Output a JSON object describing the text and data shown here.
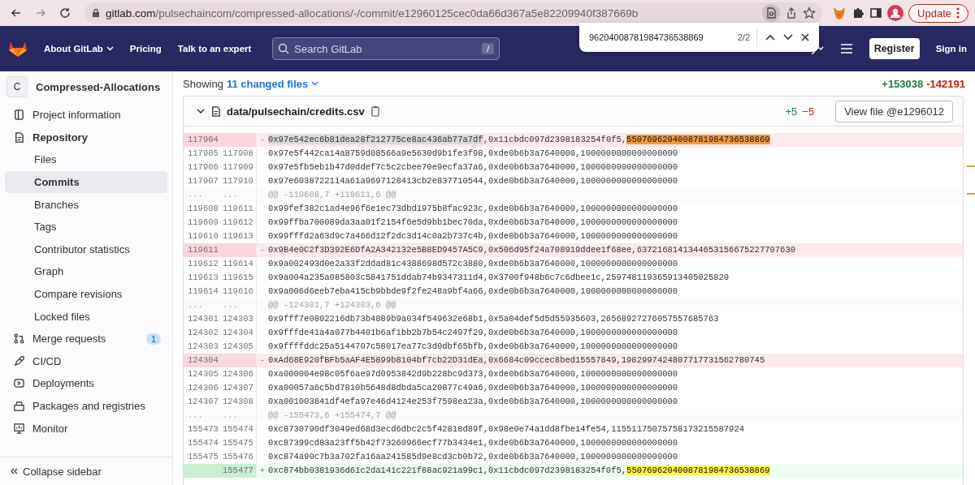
{
  "browser": {
    "url_host": "gitlab.com",
    "url_path": "/pulsechaincom/compressed-allocations/-/commit/e12960125cec0da66d367a5e82209940f387669b",
    "update_button": "Update"
  },
  "find_bar": {
    "query": "96204008781984736538869",
    "count": "2/2"
  },
  "navbar": {
    "links": [
      {
        "label": "About GitLab",
        "dropdown": true
      },
      {
        "label": "Pricing",
        "dropdown": false
      },
      {
        "label": "Talk to an expert",
        "dropdown": false
      }
    ],
    "search": {
      "placeholder": "Search GitLab",
      "shortcut": "/"
    },
    "register": "Register",
    "sign_in": "Sign in"
  },
  "sidebar": {
    "project_initial": "C",
    "project_name": "Compressed-Allocations",
    "items": [
      {
        "label": "Project information",
        "selected": false
      },
      {
        "label": "Repository",
        "selected": false,
        "children": [
          {
            "label": "Files",
            "selected": false
          },
          {
            "label": "Commits",
            "selected": true
          },
          {
            "label": "Branches",
            "selected": false
          },
          {
            "label": "Tags",
            "selected": false
          },
          {
            "label": "Contributor statistics",
            "selected": false
          },
          {
            "label": "Graph",
            "selected": false
          },
          {
            "label": "Compare revisions",
            "selected": false
          },
          {
            "label": "Locked files",
            "selected": false
          }
        ]
      },
      {
        "label": "Merge requests",
        "selected": false,
        "badge": "1"
      },
      {
        "label": "CI/CD",
        "selected": false
      },
      {
        "label": "Deployments",
        "selected": false
      },
      {
        "label": "Packages and registries",
        "selected": false
      },
      {
        "label": "Monitor",
        "selected": false
      }
    ],
    "collapse": "Collapse sidebar"
  },
  "summary": {
    "prefix": "Showing",
    "link": "11 changed files",
    "additions": "+153038",
    "deletions": "-142191"
  },
  "file": {
    "path": "data/pulsechain/credits.csv",
    "additions": "+5",
    "deletions": "−5",
    "view_button": "View file @e1296012",
    "lines": [
      {
        "kind": "deleted",
        "old": "117904",
        "sign": "-",
        "parts": [
          {
            "text": "0x97e542ec6b81dea28f212775ce8ac436ab77a7df",
            "kind": "selection"
          },
          {
            "text": ",0x11cbdc097d2398183254f0f5,",
            "kind": "plain"
          },
          {
            "text": "5507696204008781984736538869",
            "kind": "current"
          }
        ]
      },
      {
        "kind": "context",
        "old": "117905",
        "new": "117908",
        "parts": [
          {
            "text": "0x97e5f442ca14a8759d08566a9e5630d9b1fe3f98,0xde0b6b3a7640000,1000000000000000000",
            "kind": "plain"
          }
        ]
      },
      {
        "kind": "context",
        "old": "117906",
        "new": "117909",
        "parts": [
          {
            "text": "0x97e5fb5eb1b47d0ddef7c5c2cbee70e9ecfa37a6,0xde0b6b3a7640000,1000000000000000000",
            "kind": "plain"
          }
        ]
      },
      {
        "kind": "context",
        "old": "117907",
        "new": "117910",
        "parts": [
          {
            "text": "0x97e6038722114a61a9697128413cb2e837710544,0xde0b6b3a7640000,1000000000000000000",
            "kind": "plain"
          }
        ]
      },
      {
        "kind": "hunk",
        "old": "...",
        "new": "...",
        "parts": [
          {
            "text": "@@ -119608,7 +119611,6 @@",
            "kind": "plain"
          }
        ]
      },
      {
        "kind": "context",
        "old": "119608",
        "new": "119611",
        "parts": [
          {
            "text": "0x99fef382c1ad4e96f6e1ec73dbd1975b8fac923c,0xde0b6b3a7640000,1000000000000000000",
            "kind": "plain"
          }
        ]
      },
      {
        "kind": "context",
        "old": "119609",
        "new": "119612",
        "parts": [
          {
            "text": "0x99ffba700089da3aa01f2154f6e5d9bb1bec70da,0xde0b6b3a7640000,1000000000000000000",
            "kind": "plain"
          }
        ]
      },
      {
        "kind": "context",
        "old": "119610",
        "new": "119613",
        "parts": [
          {
            "text": "0x99fffd2a63d9c7a466d12f2dc3d14c0a2b737c4b,0xde0b6b3a7640000,1000000000000000000",
            "kind": "plain"
          }
        ]
      },
      {
        "kind": "deleted",
        "old": "119611",
        "sign": "-",
        "parts": [
          {
            "text": "0x9B4e0C2f3D392E6DfA2A342132e5B8ED9457A5C9,0x506d95f24a708919ddee1f68ee,6372168141344653156675227707630",
            "kind": "plain"
          }
        ]
      },
      {
        "kind": "context",
        "old": "119612",
        "new": "119614",
        "parts": [
          {
            "text": "0x9a002493d0e2a33f2ddad81c4388698d572c3880,0xde0b6b3a7640000,1000000000000000000",
            "kind": "plain"
          }
        ]
      },
      {
        "kind": "context",
        "old": "119613",
        "new": "119615",
        "parts": [
          {
            "text": "0x9a004a235a085803c5841751ddab74b9347311d4,0x3700f948b6c7c6dbee1c,259748119365913405025820",
            "kind": "plain"
          }
        ]
      },
      {
        "kind": "context",
        "old": "119614",
        "new": "119616",
        "parts": [
          {
            "text": "0x9a006d6eeb7eba415cb9bbde9f2fe248a9bf4a66,0xde0b6b3a7640000,1000000000000000000",
            "kind": "plain"
          }
        ]
      },
      {
        "kind": "hunk",
        "old": "...",
        "new": "...",
        "parts": [
          {
            "text": "@@ -124301,7 +124303,6 @@",
            "kind": "plain"
          }
        ]
      },
      {
        "kind": "context",
        "old": "124301",
        "new": "124303",
        "parts": [
          {
            "text": "0x9fff7e0802216db73b4889b9a034f549632e68b1,0x5a04def5d5d55935603,26568927276057557685763",
            "kind": "plain"
          }
        ]
      },
      {
        "kind": "context",
        "old": "124302",
        "new": "124304",
        "parts": [
          {
            "text": "0x9fffde41a4a077b4401b6af1bb2b7b54c2497f29,0xde0b6b3a7640000,1000000000000000000",
            "kind": "plain"
          }
        ]
      },
      {
        "kind": "context",
        "old": "124303",
        "new": "124305",
        "parts": [
          {
            "text": "0x9ffffddc25a5144707c58017ea77c3d0dbf65bfb,0xde0b6b3a7640000,1000000000000000000",
            "kind": "plain"
          }
        ]
      },
      {
        "kind": "deleted",
        "old": "124304",
        "sign": "-",
        "parts": [
          {
            "text": "0xAd68E920fBFb5aAF4E5899b8104bf7cb22D31dEa,0x6684c09ccec8bed15557849,1982997424807717731562780745",
            "kind": "plain"
          }
        ]
      },
      {
        "kind": "context",
        "old": "124305",
        "new": "124306",
        "parts": [
          {
            "text": "0xa000004e98c05f6ae97d0953842d9b228bc9d373,0xde0b6b3a7640000,1000000000000000000",
            "kind": "plain"
          }
        ]
      },
      {
        "kind": "context",
        "old": "124306",
        "new": "124307",
        "parts": [
          {
            "text": "0xa00057a6c5bd7810b5648d8dbda5ca20877c49a6,0xde0b6b3a7640000,1000000000000000000",
            "kind": "plain"
          }
        ]
      },
      {
        "kind": "context",
        "old": "124307",
        "new": "124308",
        "parts": [
          {
            "text": "0xa001003841df4efa97e46d4124e253f7598ea23a,0xde0b6b3a7640000,1000000000000000000",
            "kind": "plain"
          }
        ]
      },
      {
        "kind": "hunk",
        "old": "...",
        "new": "...",
        "parts": [
          {
            "text": "@@ -155473,6 +155474,7 @@",
            "kind": "plain"
          }
        ]
      },
      {
        "kind": "context",
        "old": "155473",
        "new": "155474",
        "parts": [
          {
            "text": "0xc8730790df3049ed68d3ecd6dbc2c5f42818d89f,0x98e0e74a1dd8fbe14fe54,11551175075758173215587924",
            "kind": "plain"
          }
        ]
      },
      {
        "kind": "context",
        "old": "155474",
        "new": "155475",
        "parts": [
          {
            "text": "0xc87399cd83a23ff5b42f73260966ecf77b3434e1,0xde0b6b3a7640000,1000000000000000000",
            "kind": "plain"
          }
        ]
      },
      {
        "kind": "context",
        "old": "155475",
        "new": "155476",
        "parts": [
          {
            "text": "0xc874a90c7b3a702fa16aa241585d9e8cd3cb0b72,0xde0b6b3a7640000,1000000000000000000",
            "kind": "plain"
          }
        ]
      },
      {
        "kind": "added",
        "new": "155477",
        "sign": "+",
        "parts": [
          {
            "text": "0xc874bb0381936d61c2da141c221f88ac921a99c1,0x11cbdc097d2398183254f0f5,",
            "kind": "plain"
          },
          {
            "text": "5507696204008781984736538869",
            "kind": "match"
          }
        ]
      }
    ]
  }
}
